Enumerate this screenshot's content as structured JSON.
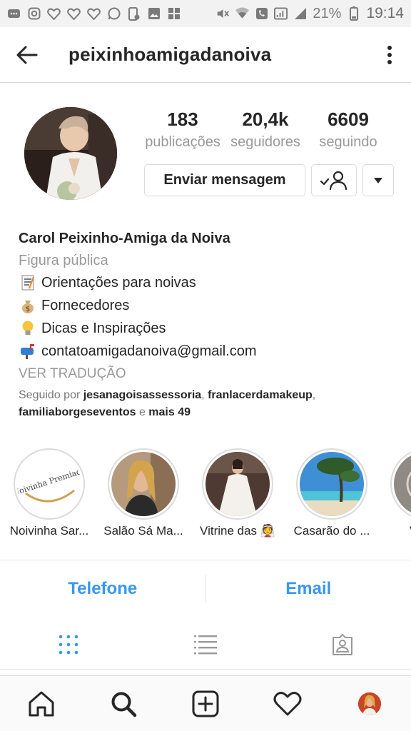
{
  "status_bar": {
    "battery": "21%",
    "time": "19:14"
  },
  "header": {
    "username": "peixinhoamigadanoiva"
  },
  "stats": [
    {
      "value": "183",
      "label": "publicações"
    },
    {
      "value": "20,4k",
      "label": "seguidores"
    },
    {
      "value": "6609",
      "label": "seguindo"
    }
  ],
  "actions": {
    "message": "Enviar mensagem"
  },
  "bio": {
    "name": "Carol Peixinho-Amiga da Noiva",
    "category": "Figura pública",
    "lines": [
      "Orientações para noivas",
      "Fornecedores",
      "Dicas e Inspirações",
      "contatoamigadanoiva@gmail.com"
    ],
    "translate": "VER TRADUÇÃO"
  },
  "followed_by": {
    "prefix": "Seguido por ",
    "user1": "jesanagoisassessoria",
    "sep1": ", ",
    "user2": "franlacerdamakeup",
    "sep2": ",",
    "user3": "familiaborgeseventos",
    "and": " e ",
    "more": "mais 49"
  },
  "highlights": [
    {
      "label": "Noivinha Sar...",
      "inner_text": "Noivinha Premiada"
    },
    {
      "label": "Salão Sá Ma..."
    },
    {
      "label": "Vitrine das 👰"
    },
    {
      "label": "Casarão do ..."
    },
    {
      "label": "Villa..."
    }
  ],
  "contact": {
    "phone": "Telefone",
    "email": "Email"
  },
  "colors": {
    "link_blue": "#3897f0",
    "tab_active": "#3897f0",
    "muted": "#999999"
  }
}
